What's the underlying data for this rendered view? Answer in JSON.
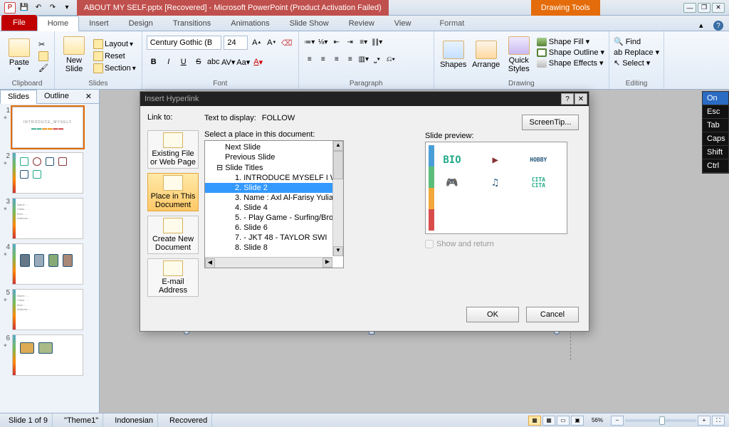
{
  "title": {
    "filename": "ABOUT MY SELF.pptx [Recovered]  -  Microsoft PowerPoint (Product Activation Failed)",
    "drawing_tools": "Drawing Tools"
  },
  "tabs": {
    "file": "File",
    "items": [
      "Home",
      "Insert",
      "Design",
      "Transitions",
      "Animations",
      "Slide Show",
      "Review",
      "View"
    ],
    "context": "Format",
    "active": "Home"
  },
  "ribbon": {
    "clipboard": {
      "label": "Clipboard",
      "paste": "Paste",
      "cut": "Cut",
      "copy": "Copy",
      "formatpainter": "Format Painter"
    },
    "slides": {
      "label": "Slides",
      "newslide": "New\nSlide",
      "layout": "Layout",
      "reset": "Reset",
      "section": "Section"
    },
    "font": {
      "label": "Font",
      "name": "Century Gothic (B",
      "size": "24"
    },
    "paragraph": {
      "label": "Paragraph"
    },
    "drawing": {
      "label": "Drawing",
      "shapes": "Shapes",
      "arrange": "Arrange",
      "quickstyles": "Quick\nStyles",
      "fill": "Shape Fill",
      "outline": "Shape Outline",
      "effects": "Shape Effects"
    },
    "editing": {
      "label": "Editing",
      "find": "Find",
      "replace": "Replace",
      "select": "Select"
    }
  },
  "leftpane": {
    "tab_slides": "Slides",
    "tab_outline": "Outline",
    "thumbs": [
      {
        "n": "1",
        "title": "INTRODUCE_MYSELF"
      },
      {
        "n": "2"
      },
      {
        "n": "3"
      },
      {
        "n": "4"
      },
      {
        "n": "5"
      },
      {
        "n": "6"
      }
    ]
  },
  "dialog": {
    "title": "Insert Hyperlink",
    "linkto": "Link to:",
    "textdisp_lbl": "Text to display:",
    "textdisp_val": "FOLLOW",
    "screentip": "ScreenTip...",
    "opts": {
      "existing": "Existing File or Web Page",
      "place": "Place in This Document",
      "createnew": "Create New Document",
      "email": "E-mail Address"
    },
    "sel_place_lbl": "Select a place in this document:",
    "tree": [
      {
        "t": "Next Slide",
        "lvl": 1
      },
      {
        "t": "Previous Slide",
        "lvl": 1
      },
      {
        "t": "Slide Titles",
        "lvl": 0,
        "exp": "⊟"
      },
      {
        "t": "1. INTRODUCE MYSELF I W",
        "lvl": 2
      },
      {
        "t": "2. Slide 2",
        "lvl": 2,
        "sel": true
      },
      {
        "t": "3. Name  : Axl Al-Farisy Yulia",
        "lvl": 2
      },
      {
        "t": "4. Slide 4",
        "lvl": 2
      },
      {
        "t": "5. - Play Game  - Surfing/Bro",
        "lvl": 2
      },
      {
        "t": "6. Slide 6",
        "lvl": 2
      },
      {
        "t": "7. - JKT 48  - TAYLOR  SWI",
        "lvl": 2
      },
      {
        "t": "8. Slide 8",
        "lvl": 2
      }
    ],
    "preview_lbl": "Slide preview:",
    "show_return": "Show and return",
    "ok": "OK",
    "cancel": "Cancel",
    "preview_icons": [
      "BIO",
      "▶",
      "HOBBY",
      "🎮",
      "♫",
      "CITA\nCITA"
    ]
  },
  "osk": [
    "On",
    "Esc",
    "Tab",
    "Caps",
    "Shift",
    "Ctrl"
  ],
  "status": {
    "slide": "Slide 1 of 9",
    "theme": "\"Theme1\"",
    "lang": "Indonesian",
    "recovered": "Recovered",
    "zoom": "56%"
  }
}
